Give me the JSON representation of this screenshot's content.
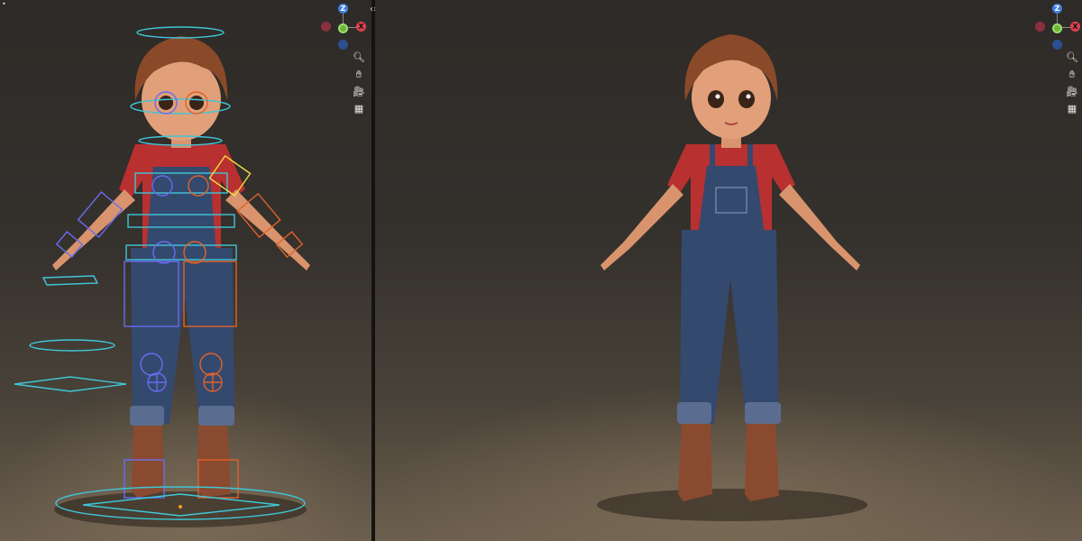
{
  "viewports": {
    "left": {
      "gizmo": {
        "z": "Z",
        "y": "Y",
        "x": "X"
      },
      "nav_icons": [
        "zoom-icon",
        "hand-pan-icon",
        "camera-icon",
        "grid-icon"
      ]
    },
    "right": {
      "gizmo": {
        "z": "Z",
        "y": "Y",
        "x": "X"
      },
      "nav_icons": [
        "zoom-icon",
        "hand-pan-icon",
        "camera-icon",
        "grid-icon"
      ]
    }
  },
  "split_handle": "‹›",
  "colors": {
    "axis_x": "#e04050",
    "axis_y": "#6bb33a",
    "axis_z": "#3f7fe0",
    "rig_cyan": "#3fc6d8",
    "rig_blue": "#6a6cf0",
    "rig_orange": "#e0622a",
    "rig_yellow": "#f0e040",
    "shirt": "#b83030",
    "denim": "#34496e",
    "hair": "#8a4a2a",
    "boots": "#8a4a30"
  }
}
